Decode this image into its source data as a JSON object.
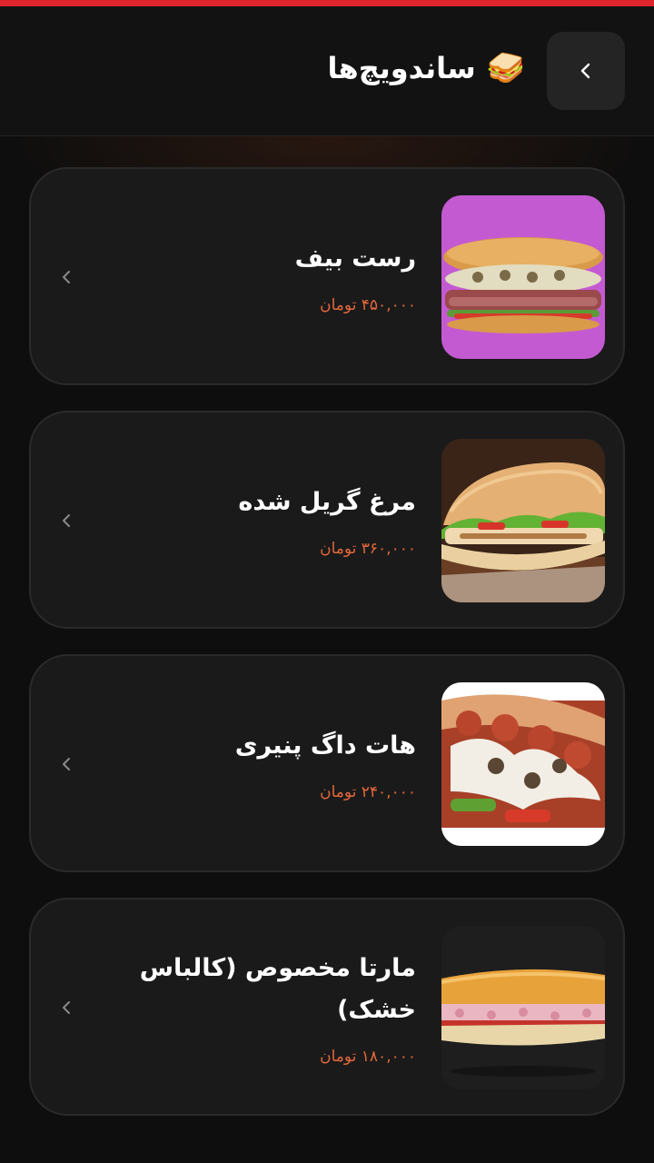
{
  "header": {
    "title": "ساندویچ‌ها",
    "emoji": "🥪",
    "back_icon": "chevron-left-icon"
  },
  "colors": {
    "accent": "#e0262d",
    "price": "#e4683c",
    "card_bg": "#1a1a1a"
  },
  "items": [
    {
      "name": "رست بیف",
      "price": "۴۵۰,۰۰۰ تومان",
      "image": "roast-beef-sandwich"
    },
    {
      "name": "مرغ گریل شده",
      "price": "۳۶۰,۰۰۰ تومان",
      "image": "grilled-chicken-sandwich"
    },
    {
      "name": "هات داگ پنیری",
      "price": "۲۴۰,۰۰۰ تومان",
      "image": "cheese-hotdog-sandwich"
    },
    {
      "name": "مارتا مخصوص (کالباس خشک)",
      "price": "۱۸۰,۰۰۰ تومان",
      "image": "salami-sandwich"
    }
  ]
}
